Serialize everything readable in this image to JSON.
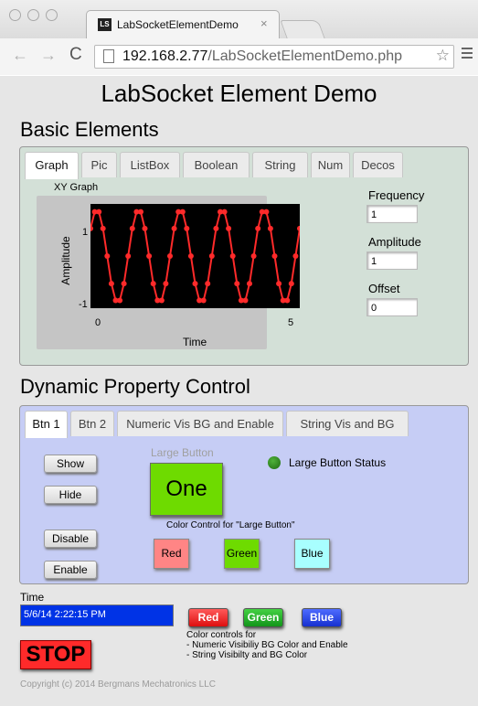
{
  "browser": {
    "tab_title": "LabSocketElementDemo",
    "favicon_text": "LS",
    "tab_close": "×",
    "url_host": "192.168.2.77",
    "url_path": "/LabSocketElementDemo.php",
    "back": "←",
    "forward": "→",
    "reload": "C",
    "star": "☆"
  },
  "page": {
    "title": "LabSocket Element Demo",
    "copyright": "Copyright (c) 2014 Bergmans Mechatronics LLC"
  },
  "basic": {
    "section_title": "Basic Elements",
    "tabs": [
      "Graph",
      "Pic",
      "ListBox",
      "Boolean",
      "String",
      "Num",
      "Decos"
    ],
    "active_tab": "Graph",
    "graph_title": "XY Graph",
    "frequency_label": "Frequency",
    "frequency_value": "1",
    "amplitude_label": "Amplitude",
    "amplitude_value": "1",
    "offset_label": "Offset",
    "offset_value": "0"
  },
  "chart_data": {
    "type": "line",
    "title": "XY Graph",
    "xlabel": "Time",
    "ylabel": "Amplitude",
    "xlim": [
      0,
      5
    ],
    "ylim": [
      -1,
      1
    ],
    "x_ticks": [
      "0",
      "5"
    ],
    "y_ticks": [
      "1",
      "-1"
    ],
    "series": [
      {
        "frequency": 1,
        "amplitude": 1,
        "offset": 0,
        "color": "#ff2a2a",
        "x": [
          0,
          0.1,
          0.2,
          0.3,
          0.4,
          0.5,
          0.6,
          0.7,
          0.8,
          0.9,
          1.0,
          1.1,
          1.2,
          1.3,
          1.4,
          1.5,
          1.6,
          1.7,
          1.8,
          1.9,
          2.0,
          2.1,
          2.2,
          2.3,
          2.4,
          2.5,
          2.6,
          2.7,
          2.8,
          2.9,
          3.0,
          3.1,
          3.2,
          3.3,
          3.4,
          3.5,
          3.6,
          3.7,
          3.8,
          3.9,
          4.0,
          4.1,
          4.2,
          4.3,
          4.4,
          4.5,
          4.6,
          4.7,
          4.8,
          4.9,
          5.0
        ],
        "y": [
          0.59,
          0.95,
          0.95,
          0.59,
          0,
          -0.59,
          -0.95,
          -0.95,
          -0.59,
          0,
          0.59,
          0.95,
          0.95,
          0.59,
          0,
          -0.59,
          -0.95,
          -0.95,
          -0.59,
          0,
          0.59,
          0.95,
          0.95,
          0.59,
          0,
          -0.59,
          -0.95,
          -0.95,
          -0.59,
          0,
          0.59,
          0.95,
          0.95,
          0.59,
          0,
          -0.59,
          -0.95,
          -0.95,
          -0.59,
          0,
          0.59,
          0.95,
          0.95,
          0.59,
          0,
          -0.59,
          -0.95,
          -0.95,
          -0.59,
          0,
          0.59
        ]
      }
    ],
    "grid": false
  },
  "dynamic": {
    "section_title": "Dynamic Property Control",
    "tabs": [
      "Btn 1",
      "Btn 2",
      "Numeric Vis BG and Enable",
      "String Vis and BG"
    ],
    "active_tab": "Btn 1",
    "show": "Show",
    "hide": "Hide",
    "disable": "Disable",
    "enable": "Enable",
    "large_button_caption": "Large Button",
    "large_button_label": "One",
    "status_label": "Large Button Status",
    "status_color": "#1f6a12",
    "color_control_label": "Color Control for \"Large Button\"",
    "color_buttons": [
      {
        "label": "Red",
        "color": "#ff8585"
      },
      {
        "label": "Green",
        "color": "#6edb00"
      },
      {
        "label": "Blue",
        "color": "#a8ffff"
      }
    ]
  },
  "bottom": {
    "time_label": "Time",
    "time_value": "5/6/14 2:22:15 PM",
    "red": "Red",
    "green": "Green",
    "blue": "Blue",
    "color_note_1": "Color controls for",
    "color_note_2": "- Numeric Visibiliy BG Color and Enable",
    "color_note_3": "- String Visibilty and BG Color",
    "stop": "STOP"
  }
}
